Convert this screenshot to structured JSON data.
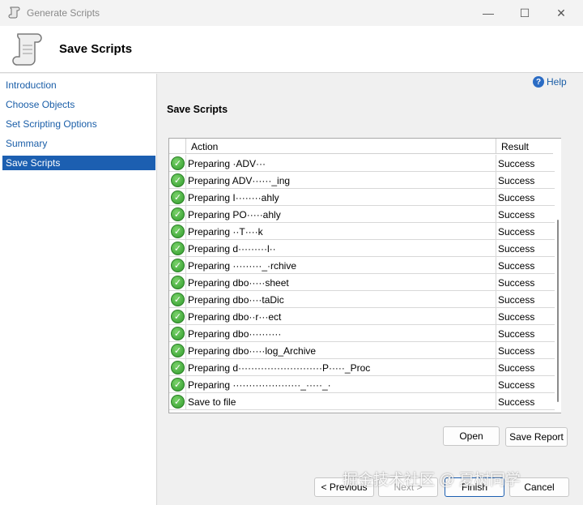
{
  "window": {
    "title": "Generate Scripts",
    "minimize_glyph": "—",
    "maximize_glyph": "☐",
    "close_glyph": "✕"
  },
  "header": {
    "title": "Save Scripts"
  },
  "sidebar": {
    "items": [
      {
        "label": "Introduction",
        "active": false
      },
      {
        "label": "Choose Objects",
        "active": false
      },
      {
        "label": "Set Scripting Options",
        "active": false
      },
      {
        "label": "Summary",
        "active": false
      },
      {
        "label": "Save Scripts",
        "active": true
      }
    ]
  },
  "main": {
    "help_label": "Help",
    "section_title": "Save Scripts",
    "columns": {
      "action": "Action",
      "result": "Result"
    },
    "rows": [
      {
        "action": "Preparing ·ADV···",
        "result": "Success"
      },
      {
        "action": "Preparing ADV······_ing",
        "result": "Success"
      },
      {
        "action": "Preparing I········ahly",
        "result": "Success"
      },
      {
        "action": "Preparing PO·····ahly",
        "result": "Success"
      },
      {
        "action": "Preparing ··T····k",
        "result": "Success"
      },
      {
        "action": "Preparing d·········l··",
        "result": "Success"
      },
      {
        "action": "Preparing ·········_·rchive",
        "result": "Success"
      },
      {
        "action": "Preparing dbo·····sheet",
        "result": "Success"
      },
      {
        "action": "Preparing dbo····taDic",
        "result": "Success"
      },
      {
        "action": "Preparing dbo··r···ect",
        "result": "Success"
      },
      {
        "action": "Preparing dbo··········",
        "result": "Success"
      },
      {
        "action": "Preparing dbo·····log_Archive",
        "result": "Success"
      },
      {
        "action": "Preparing d··························P·····_Proc",
        "result": "Success"
      },
      {
        "action": "Preparing ·····················_·····_·",
        "result": "Success"
      },
      {
        "action": "Save to file",
        "result": "Success"
      }
    ]
  },
  "buttons": {
    "open": "Open",
    "save_report": "Save Report",
    "previous": "< Previous",
    "next": "Next >",
    "finish": "Finish",
    "cancel": "Cancel"
  },
  "watermark": "掘金技术社区 @ 夏树同学",
  "colors": {
    "accent": "#1c5fb1",
    "link": "#1a5ea8",
    "success_icon": "#2e9a2a"
  }
}
